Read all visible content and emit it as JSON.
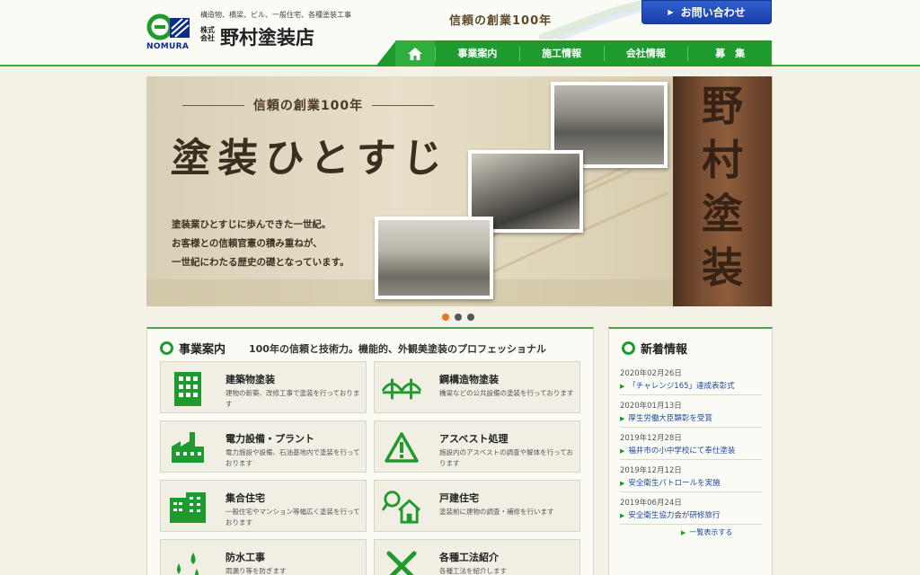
{
  "header": {
    "logo_text": "NOMURA",
    "tagline": "構造物、橋梁、ビル、一般住宅、各種塗装工事",
    "company_kind": "株式会社",
    "company_name": "野村塗装店",
    "slogan": "信頼の創業100年",
    "contact_label": "お問い合わせ"
  },
  "nav": {
    "home_icon": "home-icon",
    "items": [
      "事業案内",
      "施工情報",
      "会社情報",
      "募　集"
    ]
  },
  "hero": {
    "slogan": "信頼の創業100年",
    "title": "塗装ひとすじ",
    "copy": [
      "塗装業ひとすじに歩んできた一世紀。",
      "お客様との信頼官憲の積み重ねが、",
      "一世紀にわたる歴史の礎となっています。"
    ],
    "sign_chars": [
      "野",
      "村",
      "塗",
      "装"
    ],
    "slides": 3,
    "active_slide": 1
  },
  "business": {
    "title": "事業案内",
    "subtitle": "100年の信頼と技術力。機能的、外観美塗装のプロフェッショナル",
    "cards": [
      {
        "title": "建築物塗装",
        "desc": "建物の新築、改修工事で塗装を行っております",
        "icon": "building-icon"
      },
      {
        "title": "鋼構造物塗装",
        "desc": "橋梁などの公共設備の塗装を行っております",
        "icon": "bridge-icon"
      },
      {
        "title": "電力設備・プラント",
        "desc": "電力施設や設備、石油基地内で塗装を行っております",
        "icon": "factory-icon"
      },
      {
        "title": "アスベスト処理",
        "desc": "施設内のアスベストの調査や解体を行っております",
        "icon": "warning-icon"
      },
      {
        "title": "集合住宅",
        "desc": "一般住宅やマンション等幅広く塗装を行っております",
        "icon": "apartment-icon"
      },
      {
        "title": "戸建住宅",
        "desc": "塗装前に建物の調査・補修を行います",
        "icon": "house-search-icon"
      },
      {
        "title": "防水工事",
        "desc": "雨漏り等を防ぎます",
        "icon": "water-drop-icon"
      },
      {
        "title": "各種工法紹介",
        "desc": "各種工法を紹介します",
        "icon": "tools-icon"
      }
    ]
  },
  "news": {
    "title": "新着情報",
    "items": [
      {
        "date": "2020年02月26日",
        "title": "「チャレンジ165」達成表彰式"
      },
      {
        "date": "2020年01月13日",
        "title": "厚生労働大臣顕彰を受賞"
      },
      {
        "date": "2019年12月28日",
        "title": "福井市の小中学校にて奉仕塗装"
      },
      {
        "date": "2019年12月12日",
        "title": "安全衛生パトロールを実施"
      },
      {
        "date": "2019年06月24日",
        "title": "安全衛生協力会が研修旅行"
      }
    ],
    "more_label": "一覧表示する"
  },
  "colors": {
    "brand_green": "#1f9a2e",
    "contact_blue": "#1a3fa8",
    "link_blue": "#1d4aa0",
    "slide_active": "#e07a25"
  }
}
